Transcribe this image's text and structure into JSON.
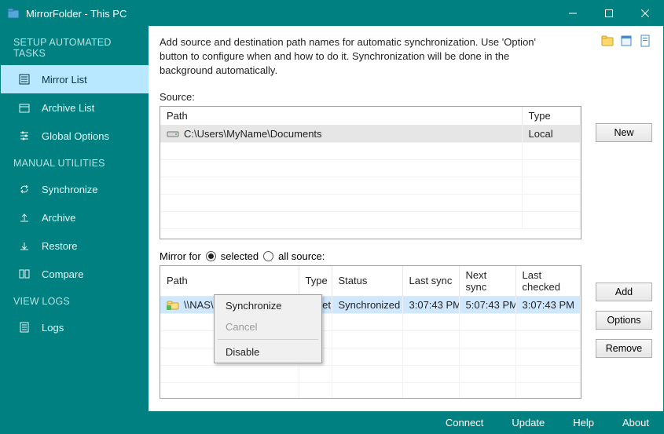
{
  "title": "MirrorFolder - This PC",
  "sidebar": {
    "headers": {
      "setup": "SETUP AUTOMATED TASKS",
      "manual": "MANUAL UTILITIES",
      "logs": "VIEW LOGS"
    },
    "items": {
      "mirror_list": "Mirror List",
      "archive_list": "Archive List",
      "global_options": "Global Options",
      "synchronize": "Synchronize",
      "archive": "Archive",
      "restore": "Restore",
      "compare": "Compare",
      "logs": "Logs"
    }
  },
  "description": "Add source and destination path names for automatic synchronization. Use 'Option' button to configure when and how to do it. Synchronization will be done in the background automatically.",
  "source": {
    "label": "Source:",
    "headers": {
      "path": "Path",
      "type": "Type"
    },
    "rows": [
      {
        "path": "C:\\Users\\MyName\\Documents",
        "type": "Local"
      }
    ]
  },
  "mirror": {
    "label_prefix": "Mirror for",
    "radio_selected": "selected",
    "radio_all": "all source:",
    "headers": {
      "path": "Path",
      "type": "Type",
      "status": "Status",
      "last_sync": "Last sync",
      "next_sync": "Next sync",
      "last_checked": "Last checked"
    },
    "rows": [
      {
        "path": "\\\\NAS\\backup\\Documents",
        "type": "WNet",
        "status": "Synchronized",
        "last_sync": "3:07:43 PM",
        "next_sync": "5:07:43 PM",
        "last_checked": "3:07:43 PM"
      }
    ]
  },
  "buttons": {
    "new": "New",
    "add": "Add",
    "options": "Options",
    "remove": "Remove"
  },
  "context_menu": {
    "synchronize": "Synchronize",
    "cancel": "Cancel",
    "disable": "Disable"
  },
  "statusbar": {
    "connect": "Connect",
    "update": "Update",
    "help": "Help",
    "about": "About"
  }
}
